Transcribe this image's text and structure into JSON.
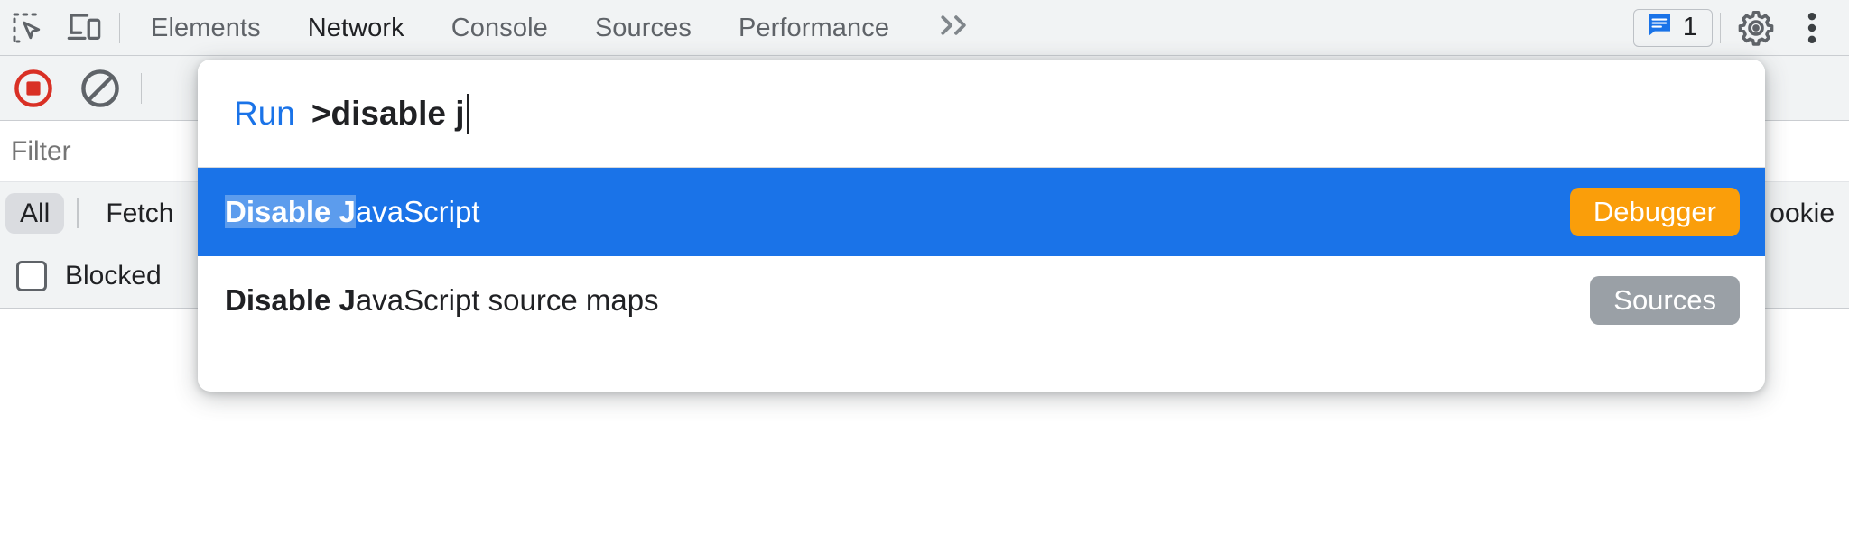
{
  "toolbar": {
    "inspect_icon": "inspect-element-icon",
    "device_icon": "device-toolbar-icon",
    "tabs": [
      {
        "label": "Elements",
        "active": false
      },
      {
        "label": "Network",
        "active": true
      },
      {
        "label": "Console",
        "active": false
      },
      {
        "label": "Sources",
        "active": false
      },
      {
        "label": "Performance",
        "active": false
      }
    ],
    "overflow_label": "»",
    "overflow_icon": "chevron-double-right-icon",
    "console_badge": {
      "icon": "console-message-icon",
      "count": "1",
      "color": "#1a73e8"
    },
    "settings_icon": "gear-icon",
    "more_icon": "kebab-menu-icon"
  },
  "network_toolbar": {
    "record_icon": "record-stop-icon",
    "record_color": "#d93025",
    "clear_icon": "clear-ban-icon"
  },
  "filter": {
    "placeholder": "Filter",
    "value": ""
  },
  "type_filters": [
    {
      "label": "All",
      "selected": true
    },
    {
      "label": "Fetch",
      "selected": false
    },
    {
      "label": "ookie",
      "selected": false
    }
  ],
  "options": {
    "blocked_label": "Blocked",
    "blocked_checked": false
  },
  "command_palette": {
    "prefix": "Run",
    "query": ">disable j",
    "results": [
      {
        "match": "Disable J",
        "rest": "avaScript",
        "badge": "Debugger",
        "badge_color": "#fa9e0a",
        "selected": true
      },
      {
        "match": "Disable J",
        "rest": "avaScript source maps",
        "badge": "Sources",
        "badge_color": "#9aa0a6",
        "selected": false
      }
    ]
  }
}
